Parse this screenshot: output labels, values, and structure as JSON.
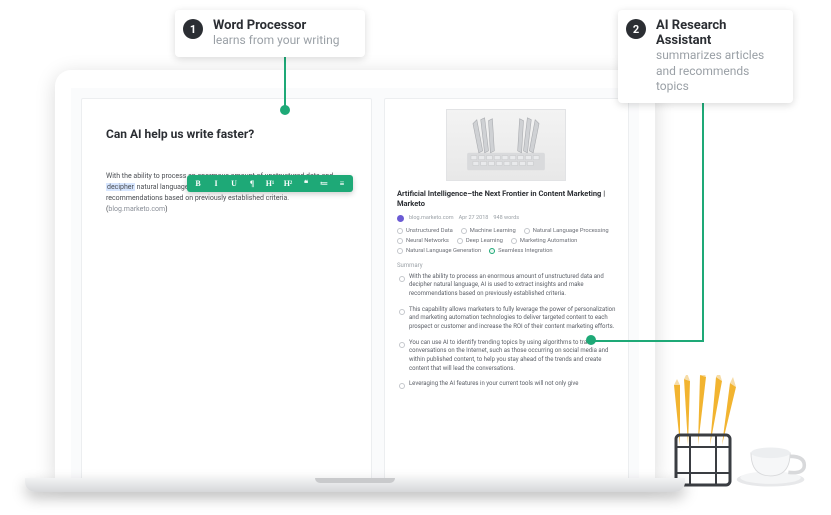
{
  "callouts": {
    "one": {
      "num": "1",
      "title": "Word Processor",
      "sub": "learns from your writing"
    },
    "two": {
      "num": "2",
      "title": "AI Research Assistant",
      "sub": "summarizes articles and recommends topics"
    }
  },
  "editor": {
    "title": "Can AI help us write faster?",
    "toolbar": [
      "B",
      "I",
      "U",
      "¶",
      "H¹",
      "H²",
      "❝",
      "≔",
      "≡"
    ],
    "paragraph_pre": "With the ability to process an enormous amount of unstructured data and ",
    "paragraph_hl": "decipher",
    "paragraph_post": " natural language, AI is used to extract insights and make recommendations based on previously established criteria. (",
    "paragraph_src": "blog.marketo.com",
    "paragraph_close": ")"
  },
  "assistant": {
    "article_title": "Artificial Intelligence–the Next Frontier in Content Marketing | Marketo",
    "source": "blog.marketo.com",
    "date": "Apr 27 2018",
    "wordcount": "948 words",
    "tags": [
      {
        "label": "Unstructured Data",
        "g": false
      },
      {
        "label": "Machine Learning",
        "g": false
      },
      {
        "label": "Natural Language Processing",
        "g": false
      },
      {
        "label": "Neural Networks",
        "g": false
      },
      {
        "label": "Deep Learning",
        "g": false
      },
      {
        "label": "Marketing Automation",
        "g": false
      },
      {
        "label": "Natural Language Generation",
        "g": false
      },
      {
        "label": "Seamless Integration",
        "g": true
      }
    ],
    "summary_heading": "Summary",
    "bullets": [
      "With the ability to process an enormous amount of unstructured data and decipher natural language, AI is used to extract insights and make recommendations based on previously established criteria.",
      "This capability allows marketers to fully leverage the power of personalization and marketing automation technologies to deliver targeted content to each prospect or customer and increase the ROI of their content marketing efforts.",
      "You can use AI to identify trending topics by using algorithms to track conversations on the Internet, such as those occurring on social media and within published content, to help you stay ahead of the trends and create content that will lead the conversations.",
      "Leveraging the AI features in your current tools will not only give"
    ]
  }
}
